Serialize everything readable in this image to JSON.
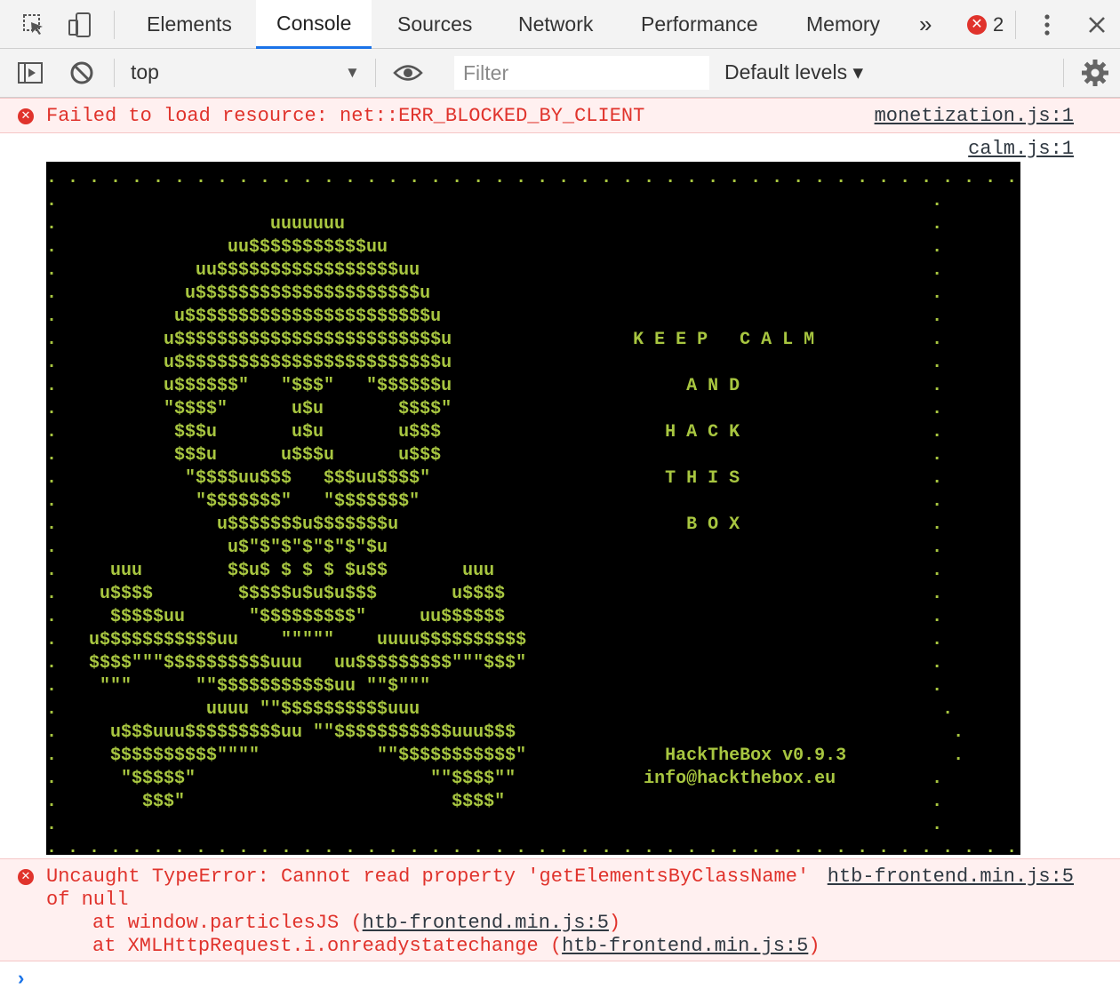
{
  "tabs": {
    "items": [
      {
        "label": "Elements"
      },
      {
        "label": "Console"
      },
      {
        "label": "Sources"
      },
      {
        "label": "Network"
      },
      {
        "label": "Performance"
      },
      {
        "label": "Memory"
      }
    ],
    "overflow": "»",
    "error_count": "2",
    "active": "Console"
  },
  "toolbar": {
    "context": "top",
    "filter_placeholder": "Filter",
    "levels": "Default levels ▾"
  },
  "console": {
    "msg1": {
      "text": "Failed to load resource: net::ERR_BLOCKED_BY_CLIENT",
      "source": "monetization.js:1"
    },
    "msg2": {
      "source": "calm.js:1",
      "ascii": [
        ". . . . . . . . . . . . . . . . . . . . . . . . . . . . . . . . . . . . . . . . . . . . . . . . . . . . . . . . . . . . . . . . . . . .",
        ".                                                                                  .",
        ".                    uuuuuuu                                                       .",
        ".                uu$$$$$$$$$$$uu                                                   .",
        ".             uu$$$$$$$$$$$$$$$$$uu                                                .",
        ".            u$$$$$$$$$$$$$$$$$$$$$u                                               .",
        ".           u$$$$$$$$$$$$$$$$$$$$$$$u                                              .",
        ".          u$$$$$$$$$$$$$$$$$$$$$$$$$u                 K E E P   C A L M           .",
        ".          u$$$$$$$$$$$$$$$$$$$$$$$$$u                                             .",
        ".          u$$$$$$\"   \"$$$\"   \"$$$$$$u                      A N D                  .",
        ".          \"$$$$\"      u$u       $$$$\"                                             .",
        ".           $$$u       u$u       u$$$                     H A C K                  .",
        ".           $$$u      u$$$u      u$$$                                              .",
        ".            \"$$$$uu$$$   $$$uu$$$$\"                      T H I S                  .",
        ".             \"$$$$$$$\"   \"$$$$$$$\"                                                .",
        ".               u$$$$$$$u$$$$$$$u                           B O X                  .",
        ".                u$\"$\"$\"$\"$\"$\"$u                                                   .",
        ".     uuu        $$u$ $ $ $ $u$$       uuu                                         .",
        ".    u$$$$        $$$$$u$u$u$$$       u$$$$                                        .",
        ".     $$$$$uu      \"$$$$$$$$$\"     uu$$$$$$                                        .",
        ".   u$$$$$$$$$$$uu    \"\"\"\"\"    uuuu$$$$$$$$$$                                      .",
        ".   $$$$\"\"\"$$$$$$$$$$uuu   uu$$$$$$$$$\"\"\"$$$\"                                      .",
        ".    \"\"\"      \"\"$$$$$$$$$$$uu \"\"$\"\"\"                                               .",
        ".              uuuu \"\"$$$$$$$$$$uuu                                                 .",
        ".     u$$$uuu$$$$$$$$$uu \"\"$$$$$$$$$$$uuu$$$                                         .",
        ".     $$$$$$$$$$\"\"\"\"           \"\"$$$$$$$$$$$\"             HackTheBox v0.9.3          .",
        ".      \"$$$$$\"                      \"\"$$$$\"\"            info@hackthebox.eu         .",
        ".        $$$\"                         $$$$\"                                        .",
        ".                                                                                  .",
        ". . . . . . . . . . . . . . . . . . . . . . . . . . . . . . . . . . . . . . . . . . . . . . . . . . . . . . . . . . . . . . . . . . . ."
      ]
    },
    "msg3": {
      "text": "Uncaught TypeError: Cannot read property 'getElementsByClassName'",
      "text2": "of null",
      "source": "htb-frontend.min.js:5",
      "stack1_prefix": "at window.particlesJS (",
      "stack1_link": "htb-frontend.min.js:5",
      "stack1_suffix": ")",
      "stack2_prefix": "at XMLHttpRequest.i.onreadystatechange (",
      "stack2_link": "htb-frontend.min.js:5",
      "stack2_suffix": ")"
    },
    "prompt": "›"
  },
  "colors": {
    "error": "#e0332c",
    "ascii": "#a8c640",
    "accent": "#1a73e8"
  },
  "icons": [
    "inspect-icon",
    "device-toggle-icon",
    "more-vert-icon",
    "close-icon",
    "sidebar-toggle-icon",
    "clear-console-icon",
    "eye-icon",
    "settings-gear-icon"
  ]
}
